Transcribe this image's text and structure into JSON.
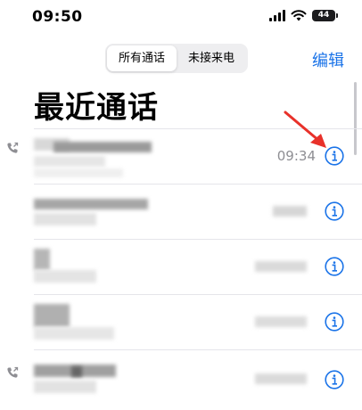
{
  "status": {
    "time": "09:50",
    "battery": "44"
  },
  "segmented": {
    "all_calls": "所有通话",
    "missed": "未接来电"
  },
  "header": {
    "edit": "编辑",
    "title": "最近通话"
  },
  "calls": [
    {
      "time": "09:34",
      "outgoing": true
    },
    {
      "time": "",
      "outgoing": false
    },
    {
      "time": "",
      "outgoing": false
    },
    {
      "time": "",
      "outgoing": false
    },
    {
      "time": "",
      "outgoing": true
    }
  ],
  "colors": {
    "accent": "#1a73e8",
    "annotation_arrow": "#e8312a"
  }
}
